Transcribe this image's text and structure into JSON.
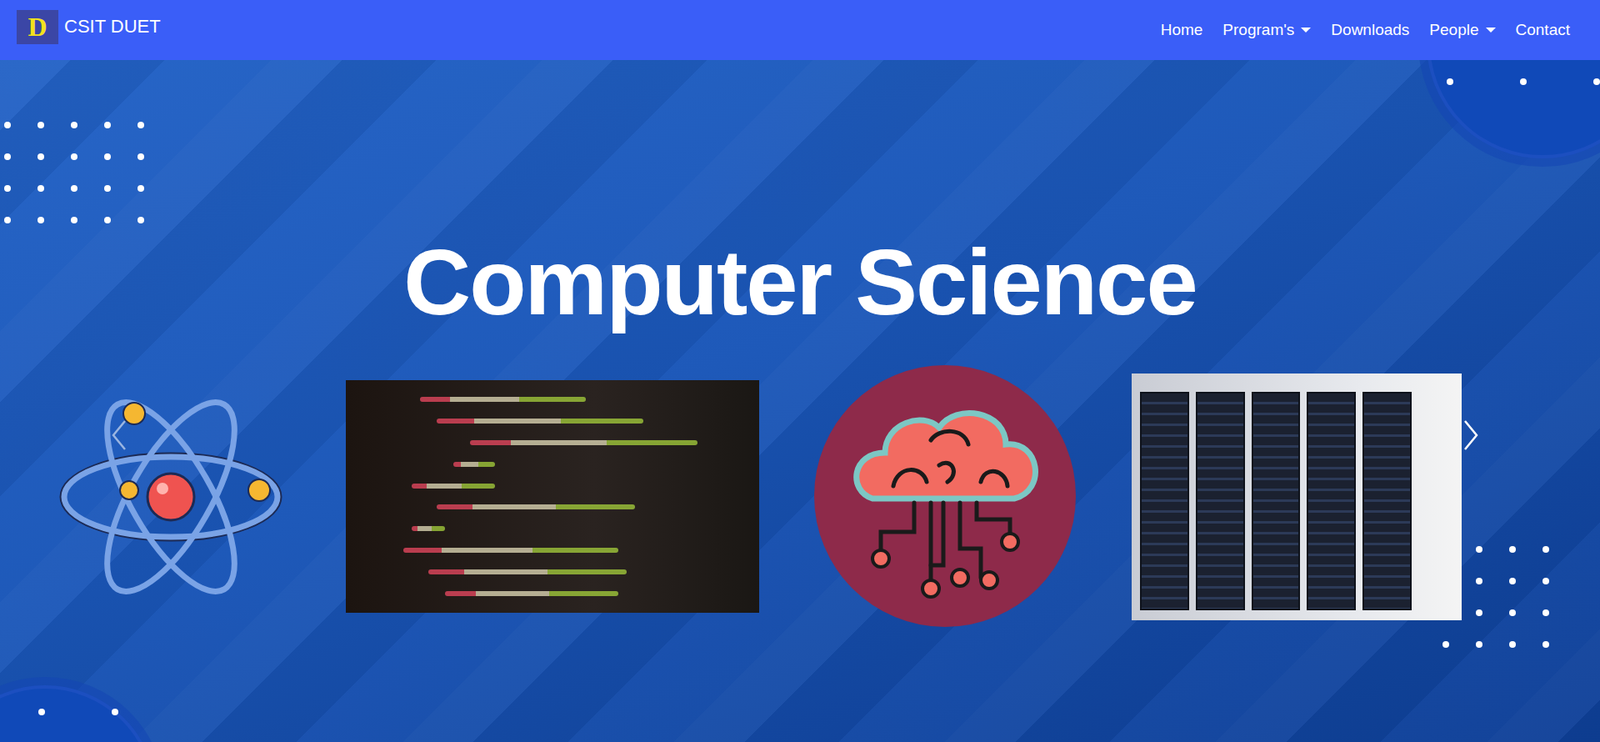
{
  "brand": {
    "letter": "D",
    "name": "CSIT DUET"
  },
  "nav": [
    {
      "label": "Home",
      "dropdown": false
    },
    {
      "label": "Program's",
      "dropdown": true
    },
    {
      "label": "Downloads",
      "dropdown": false
    },
    {
      "label": "People",
      "dropdown": true
    },
    {
      "label": "Contact",
      "dropdown": false
    }
  ],
  "hero": {
    "title": "Computer Science"
  },
  "slides": [
    {
      "kind": "atom"
    },
    {
      "kind": "code"
    },
    {
      "kind": "brain"
    },
    {
      "kind": "servers"
    }
  ]
}
